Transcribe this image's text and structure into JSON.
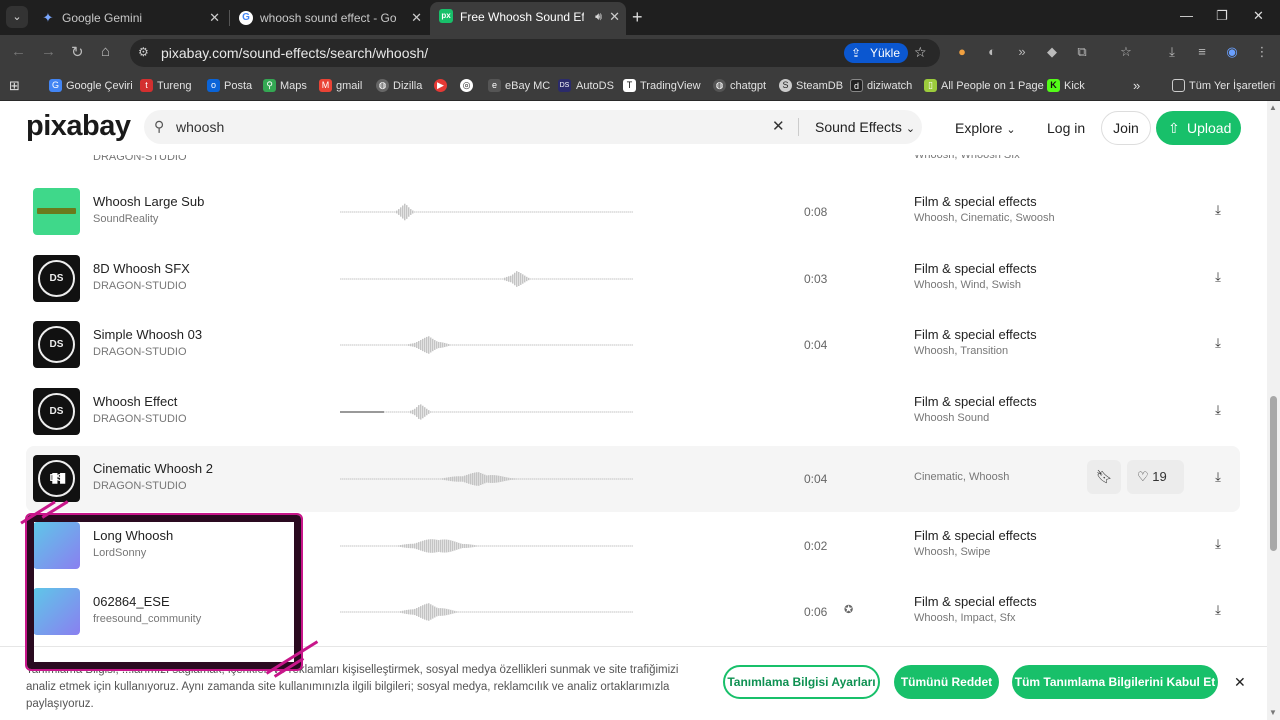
{
  "browser": {
    "tabs": [
      {
        "title": "Google Gemini",
        "icon": "gemini-icon"
      },
      {
        "title": "whoosh sound effect - Google'd",
        "icon": "google-icon"
      },
      {
        "title": "Free Whoosh Sound Effects",
        "icon": "pixabay-icon"
      }
    ],
    "url": "pixabay.com/sound-effects/search/whoosh/",
    "upload_chip": "Yükle",
    "bookmarks": [
      "Google Çeviri",
      "Tureng",
      "Posta",
      "Maps",
      "gmail",
      "Dizilla",
      "eBay MC",
      "AutoDS",
      "TradingView",
      "chatgpt",
      "SteamDB",
      "diziwatch",
      "All People on 1 Page",
      "Kick"
    ],
    "bookmarks_folder": "Tüm Yer İşaretleri"
  },
  "header": {
    "logo": "pixabay",
    "search_value": "whoosh",
    "search_type": "Sound Effects",
    "explore": "Explore",
    "login": "Log in",
    "join": "Join",
    "upload": "Upload"
  },
  "partial_row": {
    "author": "DRAGON-STUDIO",
    "tags": "Whoosh, Whoosh Sfx"
  },
  "results": [
    {
      "title": "Whoosh Large Sub",
      "author": "SoundReality",
      "duration": "0:08",
      "category": "Film & special effects",
      "tags": "Whoosh, Cinematic, Swoosh",
      "thumb": "green"
    },
    {
      "title": "8D Whoosh SFX",
      "author": "DRAGON-STUDIO",
      "duration": "0:03",
      "category": "Film & special effects",
      "tags": "Whoosh, Wind, Swish",
      "thumb": "dragon"
    },
    {
      "title": "Simple Whoosh 03",
      "author": "DRAGON-STUDIO",
      "duration": "0:04",
      "category": "Film & special effects",
      "tags": "Whoosh, Transition",
      "thumb": "dragon"
    },
    {
      "title": "Whoosh Effect",
      "author": "DRAGON-STUDIO",
      "duration": "",
      "category": "Film & special effects",
      "tags": "Whoosh Sound",
      "thumb": "dragon"
    },
    {
      "title": "Cinematic Whoosh 2",
      "author": "DRAGON-STUDIO",
      "duration": "0:04",
      "category": "",
      "tags": "Cinematic, Whoosh",
      "thumb": "dragon",
      "likes": "19"
    },
    {
      "title": "Long Whoosh",
      "author": "LordSonny",
      "duration": "0:02",
      "category": "Film & special effects",
      "tags": "Whoosh, Swipe",
      "thumb": "grad"
    },
    {
      "title": "062864_ESE",
      "author": "freesound_community",
      "duration": "0:06",
      "category": "Film & special effects",
      "tags": "Whoosh, Impact, Sfx",
      "thumb": "grad"
    }
  ],
  "cookie": {
    "text": "Tanımlama Bilgisi, ...larımızı sağlamak, içerikleri ve reklamları kişiselleştirmek, sosyal medya özellikleri sunmak ve site trafiğimizi analiz etmek için kullanıyoruz. Aynı zamanda site kullanımınızla ilgili bilgileri; sosyal medya, reklamcılık ve analiz ortaklarımızla paylaşıyoruz.",
    "settings": "Tanımlama Bilgisi Ayarları",
    "reject": "Tümünü Reddet",
    "accept": "Tüm Tanımlama Bilgilerini Kabul Et"
  },
  "colors": {
    "brand_green": "#18c06a",
    "stream_magenta": "#c8168a"
  }
}
